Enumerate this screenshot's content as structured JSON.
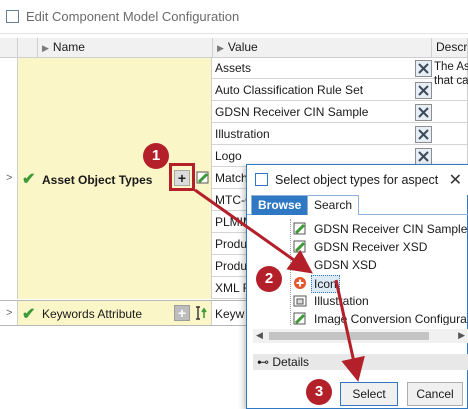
{
  "window": {
    "title": "Edit Component Model Configuration"
  },
  "columns": {
    "name": "Name",
    "value": "Value",
    "description": "Descript"
  },
  "rows": [
    {
      "name": "Asset Object Types",
      "values": [
        "Assets",
        "Auto Classification Rule Set",
        "GDSN Receiver CIN Sample",
        "Illustration",
        "Logo",
        "Matchi",
        "MTC-C",
        "PLMIM",
        "Produ",
        "Produ",
        "XML Fi"
      ],
      "description_lines": [
        "The Ass",
        "that ca"
      ]
    },
    {
      "name": "Keywords Attribute",
      "value": "Keyw"
    }
  ],
  "dialog": {
    "title": "Select object types for aspect",
    "tabs": {
      "browse": "Browse",
      "search": "Search"
    },
    "tree_items": [
      "GDSN Receiver CIN Sample",
      "GDSN Receiver XSD",
      "GDSN XSD",
      "Icon",
      "Illustration",
      "Image Conversion Configura"
    ],
    "details_label": "Details",
    "select_label": "Select",
    "cancel_label": "Cancel"
  },
  "markers": [
    "1",
    "2",
    "3"
  ],
  "colors": {
    "marker": "#b3202a",
    "accent": "#2f78c4",
    "row_highlight": "#fbf6c7",
    "check": "#3c9a37"
  }
}
